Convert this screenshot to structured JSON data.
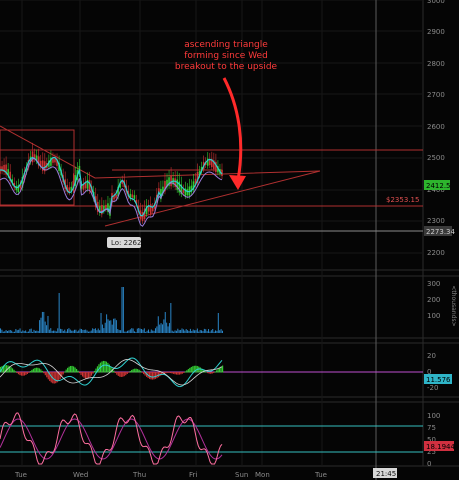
{
  "annotation": {
    "line1": "ascending triangle",
    "line2": "forming since Wed",
    "line3": "breakout to the upside"
  },
  "price_axis": {
    "ticks": [
      "3000",
      "2900",
      "2800",
      "2700",
      "2600",
      "2500",
      "2400",
      "2300",
      "2200"
    ],
    "last_price_badge": "2412.5",
    "level_label": "$2353.15",
    "low_right_label": "2273.34",
    "low_label": "Lo: 2262"
  },
  "volume_axis": {
    "ticks": [
      "300",
      "200",
      "100"
    ],
    "unit": "<thousands>"
  },
  "macd_axis": {
    "ticks": [
      "20",
      "0",
      "-20"
    ],
    "badge": "11.576"
  },
  "stoch_axis": {
    "ticks": [
      "100",
      "75",
      "50",
      "25",
      "0"
    ],
    "badge": "18.1944"
  },
  "time_axis": {
    "labels": [
      "Tue",
      "Wed",
      "Thu",
      "Fri",
      "Sun",
      "Mon",
      "Tue"
    ],
    "cursor_time": "21:45"
  },
  "colors": {
    "background": "#050505",
    "grid": "#1e1e1e",
    "annotation": "#ff3b3b",
    "up_candle": "#33cc33",
    "down_candle": "#cc3333",
    "ma_fast": "#2fd0d0",
    "ma_slow": "#9a7bd8",
    "volume": "#2a86c8",
    "stoch_fast": "#ff6fa0",
    "stoch_slow": "#b0309a",
    "overbought_line": "#35c0c0"
  }
}
